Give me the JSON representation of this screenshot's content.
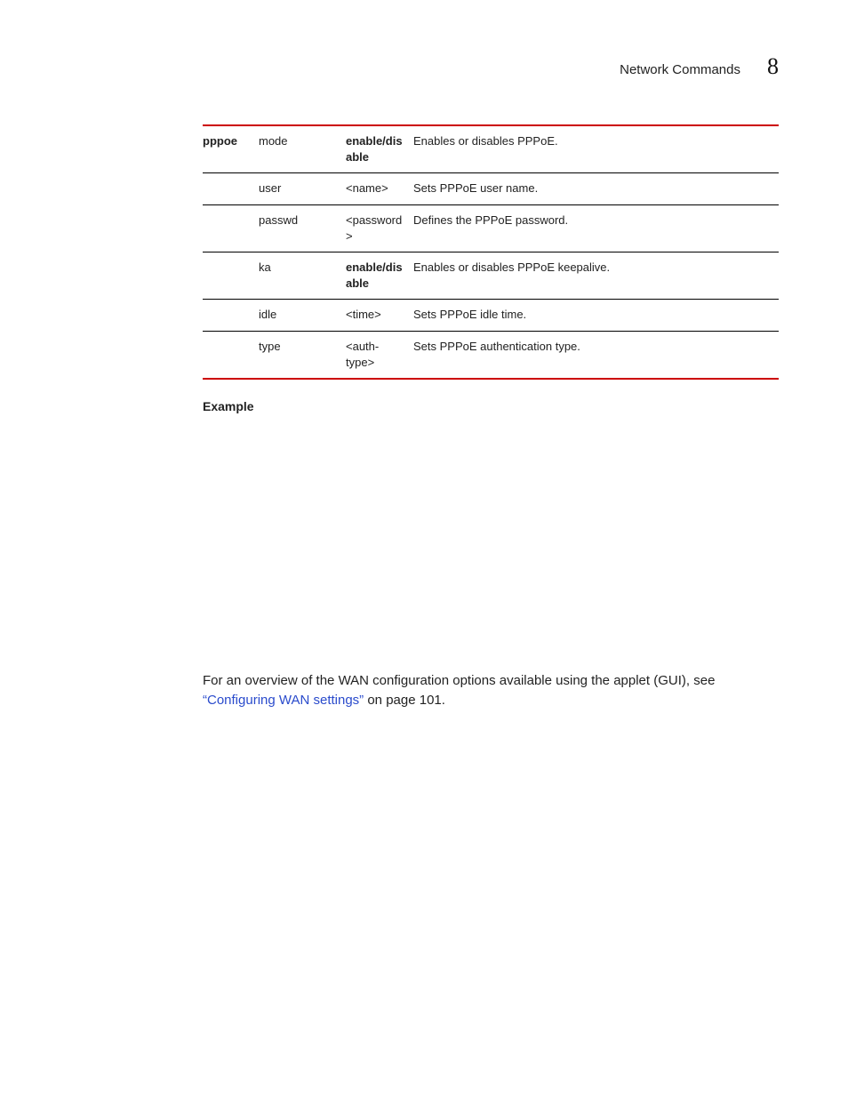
{
  "header": {
    "title": "Network Commands",
    "chapter_number": "8"
  },
  "table": {
    "rows": [
      {
        "cmd": "pppoe",
        "sub": "mode",
        "arg_bold": "enable/disable",
        "arg_plain": "",
        "desc": "Enables or disables PPPoE."
      },
      {
        "cmd": "",
        "sub": "user",
        "arg_bold": "",
        "arg_plain": "<name>",
        "desc": "Sets PPPoE user name."
      },
      {
        "cmd": "",
        "sub": "passwd",
        "arg_bold": "",
        "arg_plain": "<password>",
        "desc": "Defines the PPPoE password."
      },
      {
        "cmd": "",
        "sub": "ka",
        "arg_bold": "enable/disable",
        "arg_plain": "",
        "desc": "Enables or disables PPPoE keepalive."
      },
      {
        "cmd": "",
        "sub": "idle",
        "arg_bold": "",
        "arg_plain": "<time>",
        "desc": "Sets PPPoE idle time."
      },
      {
        "cmd": "",
        "sub": "type",
        "arg_bold": "",
        "arg_plain": "<auth-type>",
        "desc": "Sets PPPoE authentication type."
      }
    ]
  },
  "example_heading": "Example",
  "overview": {
    "pre": "For an overview of the WAN configuration options available using the applet (GUI), see ",
    "link": "“Configuring WAN settings”",
    "post": " on page 101."
  }
}
